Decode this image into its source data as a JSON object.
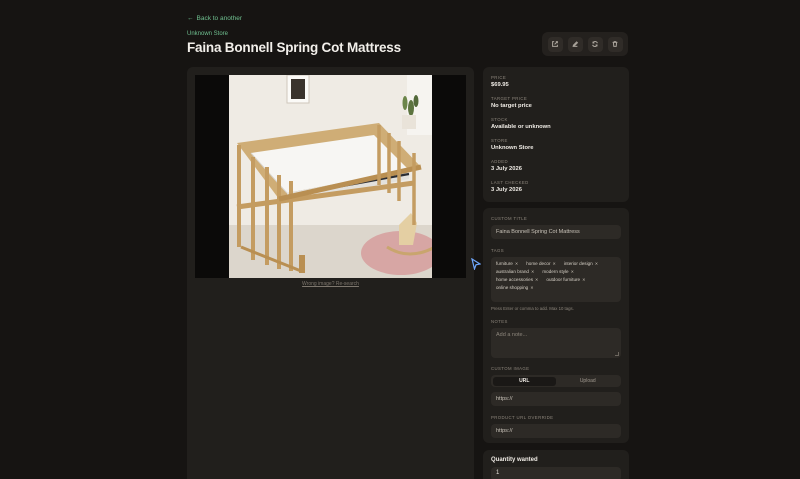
{
  "nav": {
    "back_label": "Back to another"
  },
  "product": {
    "store": "Unknown Store",
    "title": "Faina Bonnell Spring Cot Mattress"
  },
  "toolbar": {
    "icons": [
      "external-link-icon",
      "edit-icon",
      "refresh-icon",
      "trash-icon"
    ]
  },
  "image": {
    "credit": "Wrong image? Re-search"
  },
  "info": {
    "price_label": "Price",
    "price_value": "$69.95",
    "target_label": "Target price",
    "target_value": "No target price",
    "stock_label": "Stock",
    "stock_value": "Available or unknown",
    "store_label": "Store",
    "store_value": "Unknown Store",
    "added_label": "Added",
    "added_value": "3 July 2026",
    "checked_label": "Last checked",
    "checked_value": "3 July 2026"
  },
  "edit": {
    "custom_title_label": "Custom title",
    "custom_title_value": "Faina Bonnell Spring Cot Mattress",
    "tags_label": "Tags",
    "tags": [
      "furniture",
      "home decor",
      "interior design",
      "australian brand",
      "modern style",
      "home accessories",
      "outdoor furniture",
      "online shopping"
    ],
    "tags_hint": "Press Enter or comma to add. Max 10 tags.",
    "notes_label": "Notes",
    "notes_placeholder": "Add a note...",
    "custom_image_label": "Custom image",
    "seg_url": "URL",
    "seg_upload": "Upload",
    "image_url_placeholder": "https://",
    "override_label": "Product URL override",
    "override_placeholder": "https://"
  },
  "quantity": {
    "label": "Quantity wanted",
    "value": "1"
  },
  "colors": {
    "accent": "#6fbf8f",
    "background": "#161412",
    "card": "#211f1c"
  }
}
